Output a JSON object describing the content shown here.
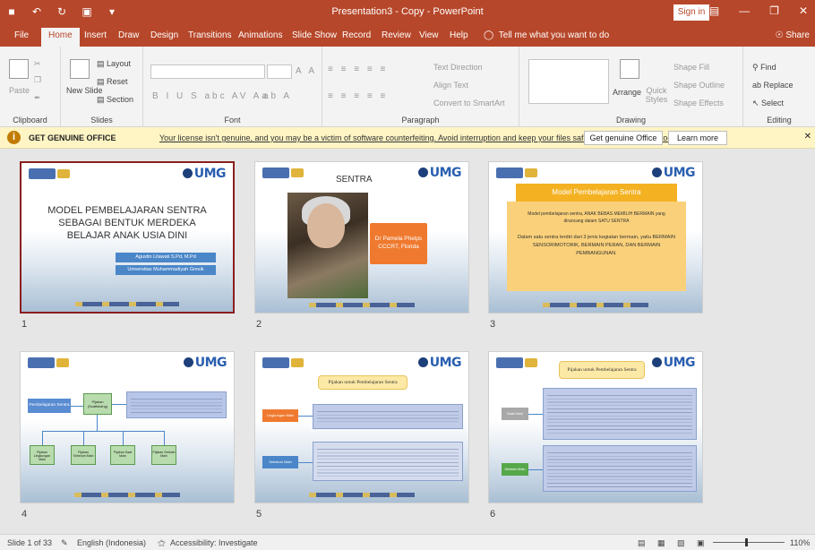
{
  "titlebar": {
    "title": "Presentation3 - Copy  -  PowerPoint",
    "signin": "Sign in"
  },
  "tabs": [
    "File",
    "Home",
    "Insert",
    "Draw",
    "Design",
    "Transitions",
    "Animations",
    "Slide Show",
    "Record",
    "Review",
    "View",
    "Help"
  ],
  "active_tab": "Home",
  "tellme": "Tell me what you want to do",
  "share": "Share",
  "ribbon": {
    "clipboard": {
      "label": "Clipboard",
      "paste": "Paste"
    },
    "slides": {
      "label": "Slides",
      "new_slide": "New Slide",
      "layout": "Layout",
      "reset": "Reset",
      "section": "Section"
    },
    "font": {
      "label": "Font"
    },
    "paragraph": {
      "label": "Paragraph",
      "text_direction": "Text Direction",
      "align_text": "Align Text",
      "convert_smartart": "Convert to SmartArt"
    },
    "drawing": {
      "label": "Drawing",
      "arrange": "Arrange",
      "quick_styles": "Quick Styles",
      "shape_fill": "Shape Fill",
      "shape_outline": "Shape Outline",
      "shape_effects": "Shape Effects"
    },
    "editing": {
      "label": "Editing",
      "find": "Find",
      "replace": "Replace",
      "select": "Select"
    }
  },
  "warning": {
    "title": "GET GENUINE OFFICE",
    "message": "Your license isn't genuine, and you may be a victim of software counterfeiting. Avoid interruption and keep your files safe with genuine Office today.",
    "button_primary": "Get genuine Office",
    "button_secondary": "Learn more"
  },
  "slides": [
    {
      "number": "1",
      "title_lines": [
        "MODEL PEMBELAJARAN SENTRA",
        "SEBAGAI BENTUK MERDEKA",
        "BELAJAR ANAK USIA DINI"
      ],
      "author": "Agustin Lilawati S.Pd, M.Pd",
      "affiliation": "Universitas Muhammadiyah Gresik"
    },
    {
      "number": "2",
      "title": "SENTRA",
      "caption_lines": [
        "Dr Pamela Phelps",
        "CCCRT, Florida"
      ]
    },
    {
      "number": "3",
      "heading": "Model Pembelajaran Sentra",
      "para1": "Model pembelajaran sentra, ANAK BEBAS MEMILIH BERMAIN yang dirancang dalam SATU SENTRA",
      "para2": "Dalam satu sentra terdiri dari 3 jenis kegiatan bermain, yaitu BERMAIN SENSORIMOTORIK, BERMAIN PERAN, DAN BERMAIN PEMBANGUNAN."
    },
    {
      "number": "4",
      "main": "Pembelajaran Sentra",
      "center": "Pijakan (Scaffolding)",
      "children": [
        "Pijakan Lingkungan Main",
        "Pijakan Sebelum Main",
        "Pijakan Saat Main",
        "Pijakan Setelah Main"
      ]
    },
    {
      "number": "5",
      "banner": "Pijakan untuk Pembelajaran Sentra",
      "label1": "Lingkungan Main",
      "label2": "Sebelum Main"
    },
    {
      "number": "6",
      "banner": "Pijakan untuk Pembelajaran Sentra",
      "label1": "Saat Main",
      "label2": "Setelah Main"
    }
  ],
  "status": {
    "slide": "Slide 1 of 33",
    "language": "English (Indonesia)",
    "accessibility": "Accessibility: Investigate",
    "zoom": "110%"
  }
}
